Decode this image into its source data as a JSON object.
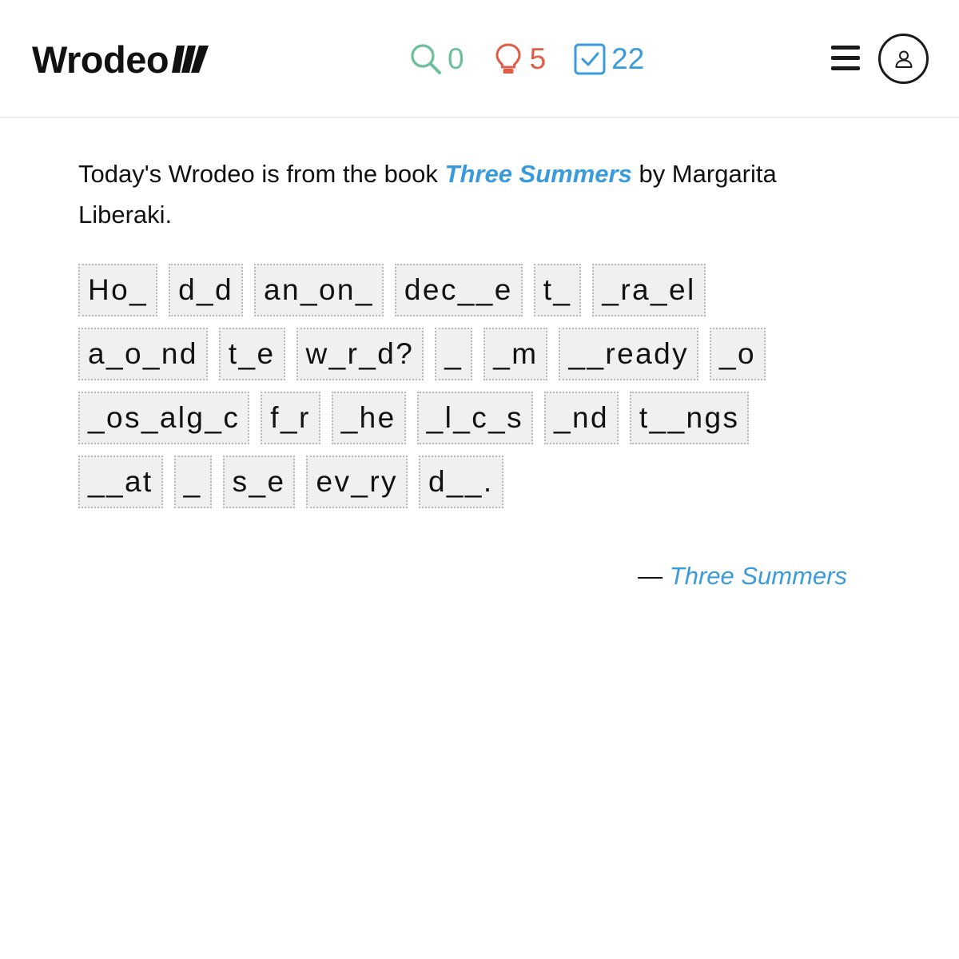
{
  "header": {
    "logo_text": "Wrodeo",
    "stats": {
      "search": {
        "icon": "search-icon",
        "value": "0",
        "color": "#6cbf9a"
      },
      "hints": {
        "icon": "lightbulb-icon",
        "value": "5",
        "color": "#e05d48"
      },
      "solved": {
        "icon": "checkbox-icon",
        "value": "22",
        "color": "#3a9bdc"
      }
    },
    "menu_icon": "hamburger-menu-icon",
    "account_icon": "user-icon"
  },
  "intro": {
    "prefix": "Today's Wrodeo is from the book ",
    "book_title": "Three Summers",
    "suffix": " by Margarita Liberaki."
  },
  "puzzle": {
    "words": [
      "Ho_",
      "d_d",
      "an_on_",
      "dec__e",
      "t_",
      "_ra_el",
      "a_o_nd",
      "t_e",
      "w_r_d?",
      "_",
      "_m",
      "__ready",
      "_o",
      "_os_alg_c",
      "f_r",
      "_he",
      "_l_c_s",
      "_nd",
      "t__ngs",
      "__at",
      "_",
      "s_e",
      "ev_ry",
      "d__."
    ]
  },
  "attribution": {
    "dash": "— ",
    "source": "Three Summers"
  },
  "colors": {
    "accent": "#3a9bdc",
    "search": "#6cbf9a",
    "hint": "#e05d48",
    "tile_bg": "#f0f0f0",
    "tile_border": "#b9b9b9"
  }
}
